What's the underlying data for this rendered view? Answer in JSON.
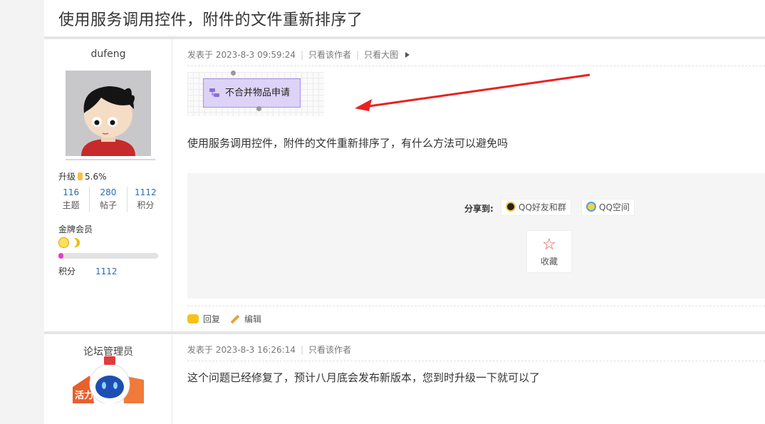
{
  "thread": {
    "title": "使用服务调用控件，附件的文件重新排序了"
  },
  "posts": [
    {
      "author": {
        "name": "dufeng",
        "upgrade_label": "升级",
        "upgrade_percent": "5.6%",
        "stats": [
          {
            "value": "116",
            "label": "主题"
          },
          {
            "value": "280",
            "label": "帖子"
          },
          {
            "value": "1112",
            "label": "积分"
          }
        ],
        "member_level": "金牌会员",
        "level_progress": 0.05,
        "points_label": "积分",
        "points_value": "1112"
      },
      "meta": {
        "posted": "发表于 2023-8-3 09:59:24",
        "only_author": "只看该作者",
        "view_large": "只看大图"
      },
      "flow_node_label": "不合并物品申请",
      "content": "使用服务调用控件，附件的文件重新排序了，有什么方法可以避免吗",
      "share": {
        "label": "分享到:",
        "qq_friends": "QQ好友和群",
        "qq_zone": "QQ空间",
        "favorite": "收藏"
      },
      "actions": {
        "reply": "回复",
        "edit": "编辑"
      }
    },
    {
      "author": {
        "name": "论坛管理员"
      },
      "meta": {
        "posted": "发表于 2023-8-3 16:26:14",
        "only_author": "只看该作者"
      },
      "content": "这个问题已经修复了，预计八月底会发布新版本，您到时升级一下就可以了"
    }
  ],
  "colors": {
    "link": "#2b6cb0",
    "flow_node_bg": "#ddd3f7",
    "annotation_arrow": "#e8231f",
    "progress_fill": "#e93dc4"
  }
}
